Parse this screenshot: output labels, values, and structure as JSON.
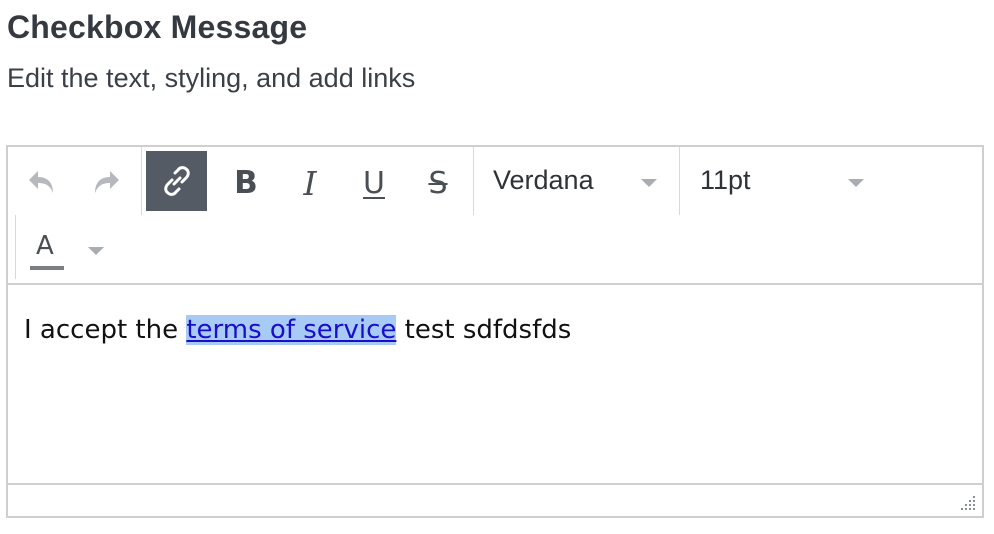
{
  "header": {
    "title": "Checkbox Message",
    "subtitle": "Edit the text, styling, and add links"
  },
  "toolbar": {
    "buttons": [
      {
        "name": "undo",
        "icon": "undo-icon",
        "enabled": false
      },
      {
        "name": "redo",
        "icon": "redo-icon",
        "enabled": false
      },
      {
        "name": "link",
        "icon": "link-icon",
        "active": true
      },
      {
        "name": "bold",
        "icon": "bold-icon",
        "glyph": "B"
      },
      {
        "name": "italic",
        "icon": "italic-icon",
        "glyph": "I"
      },
      {
        "name": "underline",
        "icon": "underline-icon",
        "glyph": "U"
      },
      {
        "name": "strikethrough",
        "icon": "strikethrough-icon",
        "glyph": "S"
      },
      {
        "name": "text-color",
        "icon": "text-color-icon",
        "glyph": "A"
      }
    ],
    "font_family": "Verdana",
    "font_size": "11pt"
  },
  "content": {
    "text_before": "I accept the ",
    "link_text": "terms of service",
    "text_after": " test sdfdsfds"
  },
  "colors": {
    "active_button_bg": "#545b64",
    "link_color": "#1a0dcc",
    "selection_highlight": "#a7cbf5",
    "border": "#cfcfcf"
  }
}
